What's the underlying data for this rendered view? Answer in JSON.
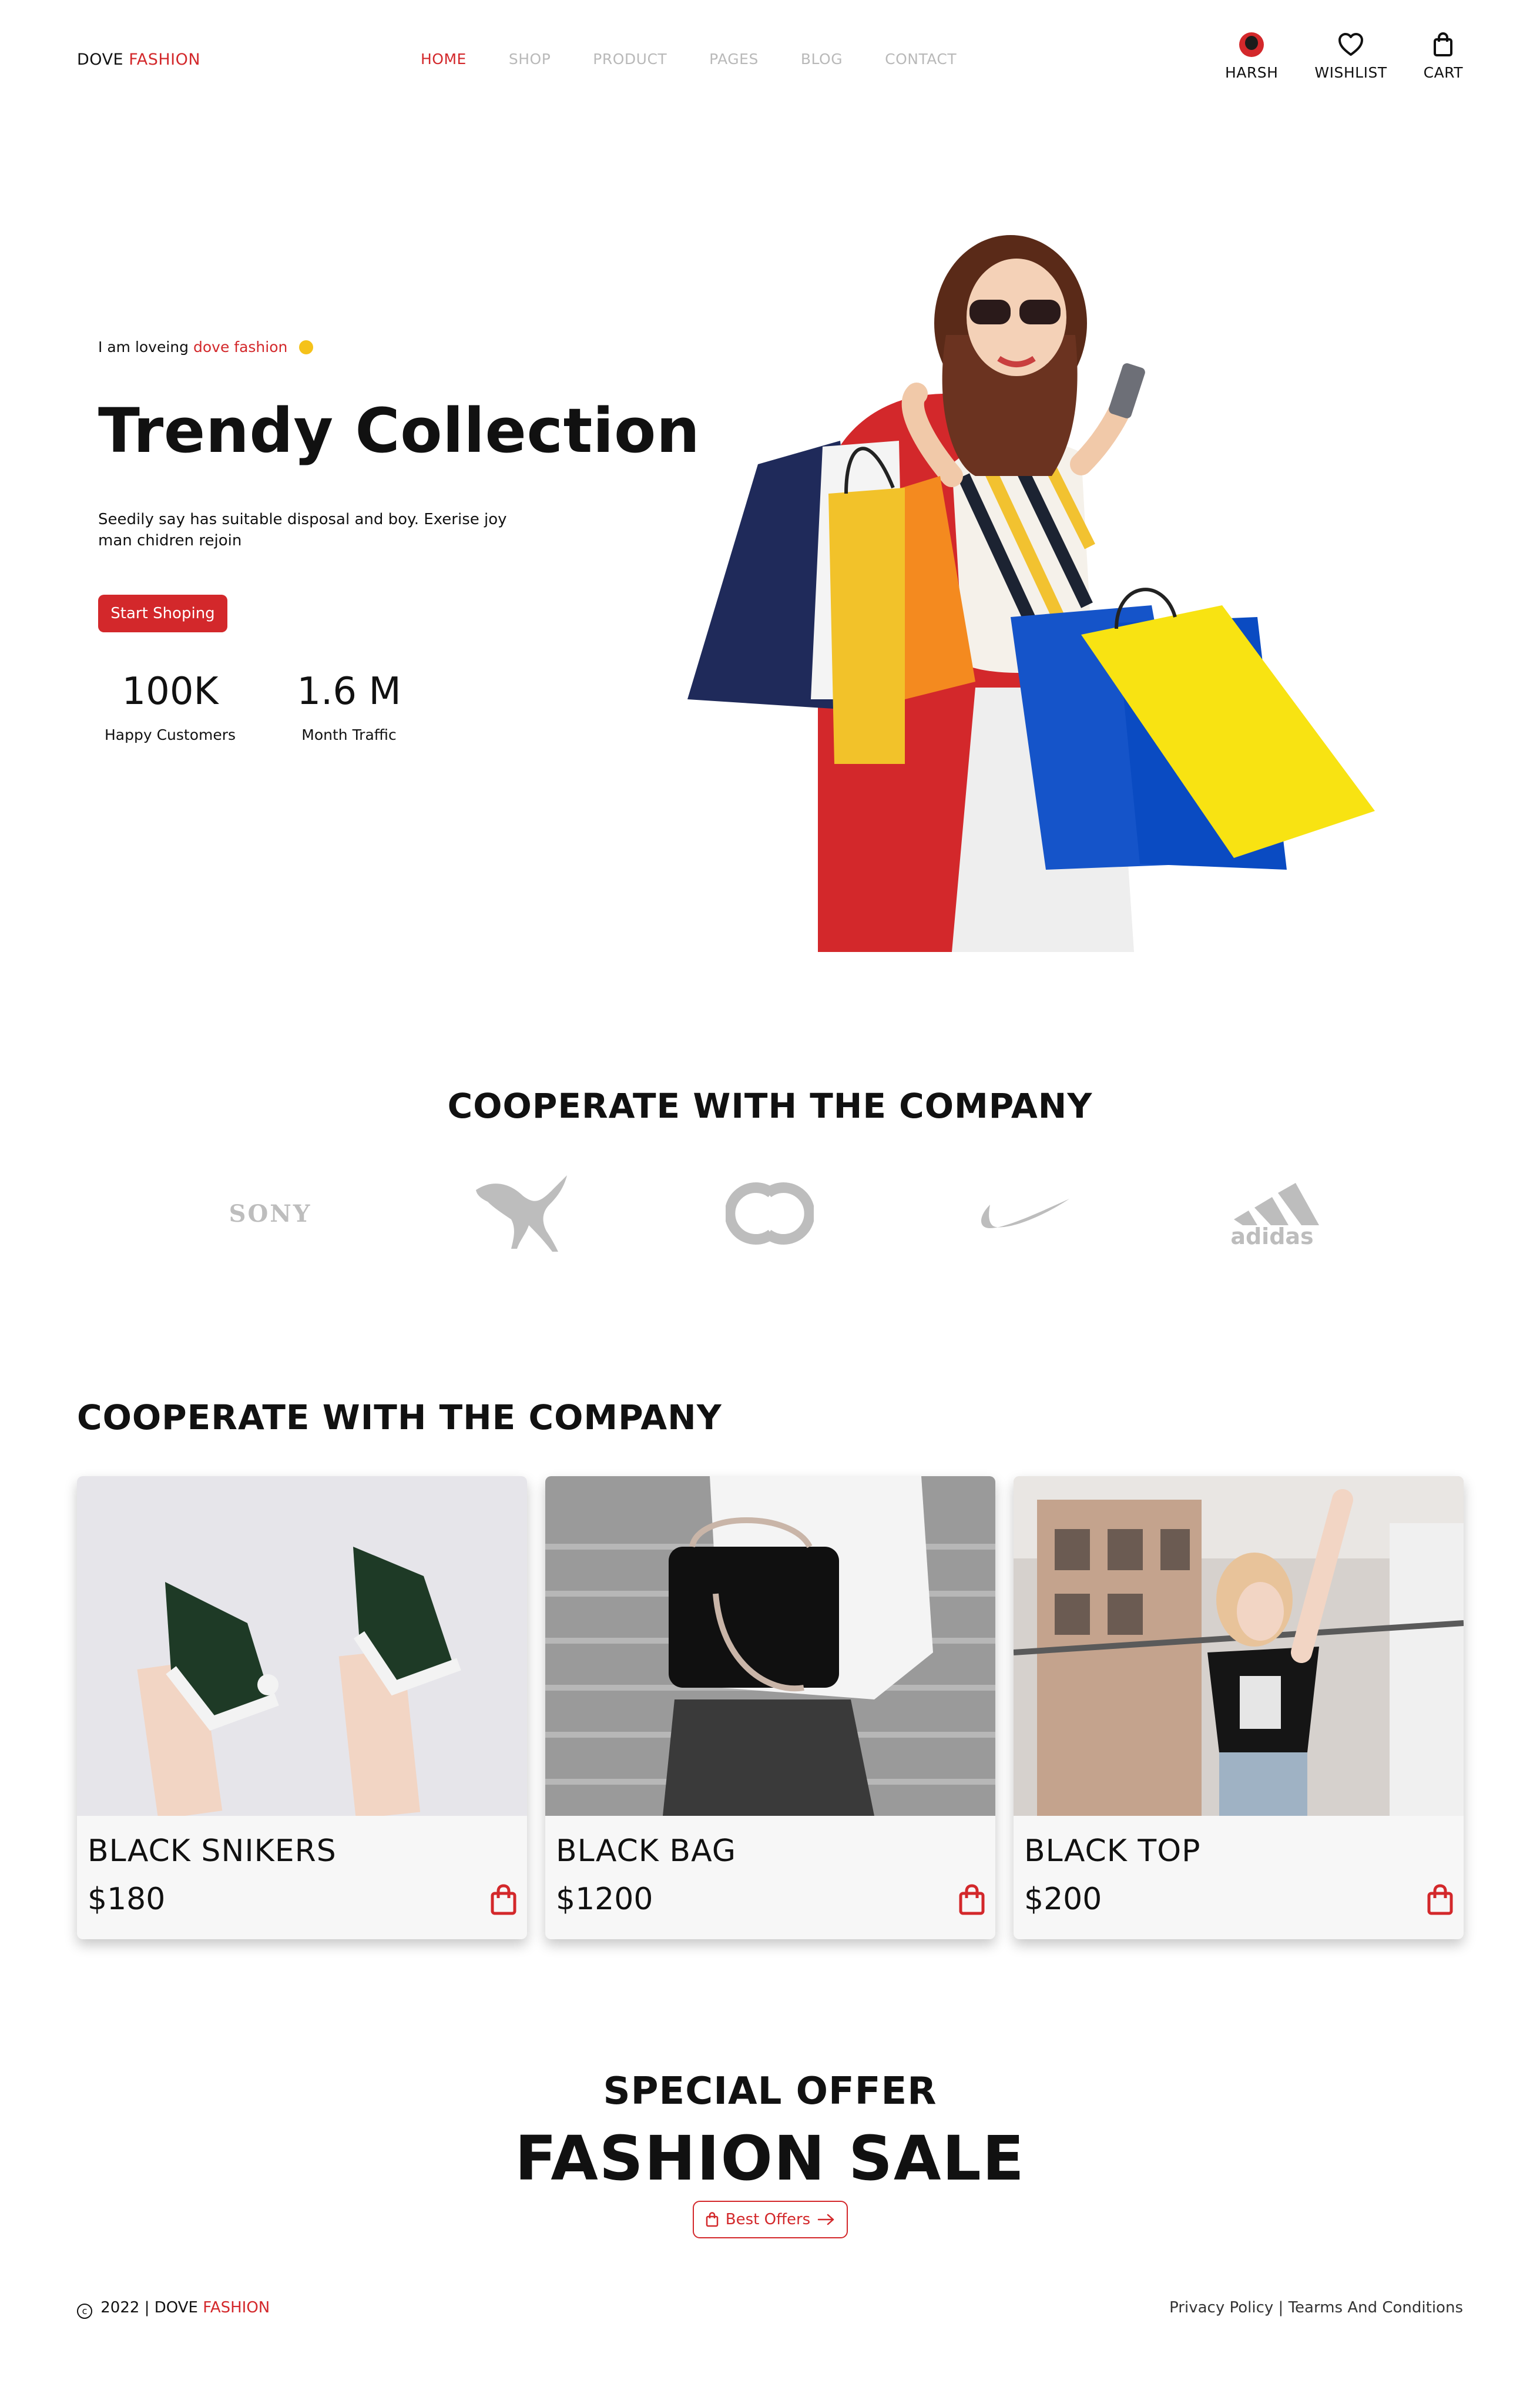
{
  "header": {
    "logo_main": "DOVE",
    "logo_accent": "FASHION",
    "nav": [
      "HOME",
      "SHOP",
      "PRODUCT",
      "PAGES",
      "BLOG",
      "CONTACT"
    ],
    "active_nav": "HOME",
    "user_label": "HARSH",
    "wishlist_label": "WISHLIST",
    "cart_label": "CART"
  },
  "hero": {
    "tagline_prefix": "I am loveing",
    "tagline_accent": "dove fashion",
    "title": "Trendy Collection",
    "description": "Seedily say has suitable disposal and boy. Exerise joy man chidren rejoin",
    "cta_label": "Start Shoping",
    "stats": [
      {
        "value": "100K",
        "label": "Happy Customers"
      },
      {
        "value": "1.6 M",
        "label": "Month Traffic"
      }
    ]
  },
  "brands": {
    "title": "COOPERATE WITH THE COMPANY",
    "items": [
      "SONY",
      "puma",
      "chanel",
      "nike",
      "adidas"
    ]
  },
  "products": {
    "title": "COOPERATE WITH THE COMPANY",
    "items": [
      {
        "name": "BLACK SNIKERS",
        "price": "$180"
      },
      {
        "name": "BLACK BAG",
        "price": "$1200"
      },
      {
        "name": "BLACK TOP",
        "price": "$200"
      }
    ]
  },
  "offer": {
    "subtitle": "SPECIAL OFFER",
    "title": "FASHION SALE",
    "button_label": "Best Offers"
  },
  "footer": {
    "year": "2022",
    "separator": "|",
    "brand_main": "DOVE",
    "brand_accent": "FASHION",
    "privacy": "Privacy Policy",
    "terms": "Tearms And Conditions"
  },
  "colors": {
    "accent": "#d3282b",
    "text": "#111111",
    "muted": "#b9b9b9",
    "logo_gray": "#bdbdbd"
  }
}
